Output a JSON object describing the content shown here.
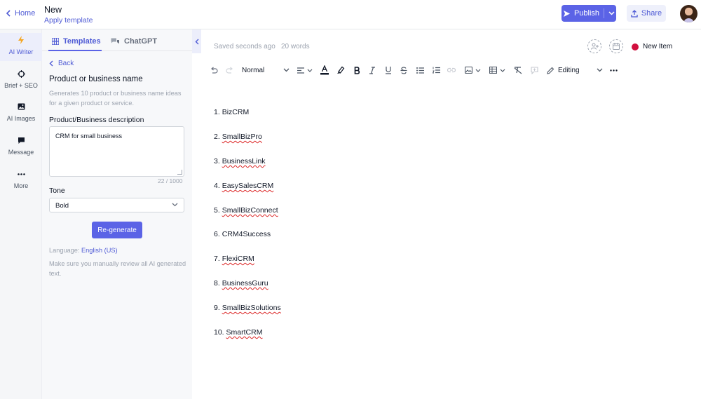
{
  "header": {
    "home_label": "Home",
    "doc_title": "New",
    "apply_template": "Apply template",
    "publish_label": "Publish",
    "share_label": "Share"
  },
  "rail": {
    "items": [
      {
        "label": "AI Writer",
        "icon": "bolt-icon"
      },
      {
        "label": "Brief + SEO",
        "icon": "target-icon"
      },
      {
        "label": "AI Images",
        "icon": "image-icon"
      },
      {
        "label": "Message",
        "icon": "chat-bubble-icon"
      },
      {
        "label": "More",
        "icon": "ellipsis-icon"
      }
    ]
  },
  "panel": {
    "tabs": [
      {
        "label": "Templates",
        "icon": "grid-icon"
      },
      {
        "label": "ChatGPT",
        "icon": "chat-bubbles-icon"
      }
    ],
    "back_label": "Back",
    "template_title": "Product or business name",
    "template_description": "Generates 10 product or business name ideas for a given product or service.",
    "description_label": "Product/Business description",
    "description_value": "CRM for small business",
    "char_count": "22 / 1000",
    "tone_label": "Tone",
    "tone_value": "Bold",
    "regenerate_label": "Re-generate",
    "language_label": "Language:",
    "language_value": "English (US)",
    "review_note": "Make sure you manually review all AI generated text."
  },
  "editor": {
    "status": "Saved seconds ago",
    "word_count": "20 words",
    "item_label": "New Item",
    "item_status_color": "#d1103e",
    "toolbar": {
      "paragraph_style": "Normal",
      "mode": "Editing"
    },
    "list": [
      {
        "num": "1.",
        "text": "BizCRM",
        "flagged": false
      },
      {
        "num": "2.",
        "text": "SmallBizPro",
        "flagged": true
      },
      {
        "num": "3.",
        "text": "BusinessLink",
        "flagged": true
      },
      {
        "num": "4.",
        "text": "EasySalesCRM",
        "flagged": true
      },
      {
        "num": "5.",
        "text": "SmallBizConnect",
        "flagged": true
      },
      {
        "num": "6.",
        "text": "CRM4Success",
        "flagged": false
      },
      {
        "num": "7.",
        "text": "FlexiCRM",
        "flagged": true
      },
      {
        "num": "8.",
        "text": "BusinessGuru",
        "flagged": true
      },
      {
        "num": "9.",
        "text": "SmallBizSolutions",
        "flagged": true
      },
      {
        "num": "10.",
        "text": "SmartCRM",
        "flagged": true
      }
    ]
  },
  "colors": {
    "accent": "#5b63e6",
    "link": "#4f5bd5"
  }
}
